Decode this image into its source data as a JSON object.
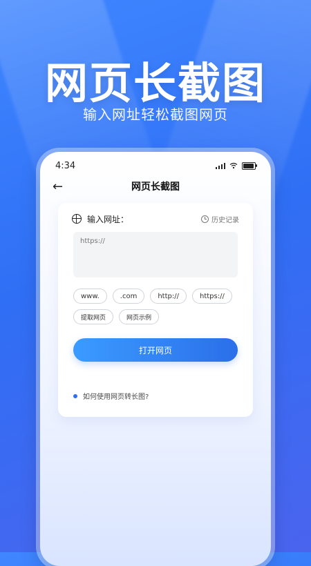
{
  "hero": {
    "title": "网页长截图",
    "subtitle": "输入网址轻松截图网页"
  },
  "phone": {
    "status_time": "4:34",
    "nav_title": "网页长截图",
    "card": {
      "label": "输入网址：",
      "history_label": "历史记录",
      "url_placeholder": "https://",
      "chips": [
        "www.",
        ".com",
        "http://",
        "https://",
        "提取网页",
        "网页示例"
      ],
      "open_button": "打开网页",
      "help_text": "如何使用网页转长图?"
    }
  },
  "icons": {
    "back": "arrow-left-icon",
    "globe": "globe-icon",
    "history": "clock-icon",
    "signal": "signal-icon",
    "wifi": "wifi-icon",
    "battery": "battery-icon"
  },
  "colors": {
    "background": "#2f6ff5",
    "primary_button": "#2b6fe9",
    "accent": "#3b9bff"
  }
}
